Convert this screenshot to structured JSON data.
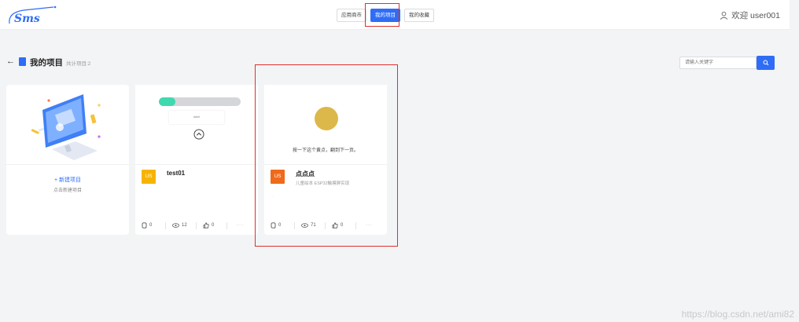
{
  "logo": {
    "text": "Sms"
  },
  "nav": {
    "tabs": [
      {
        "label": "应用商市"
      },
      {
        "label": "我的项目"
      },
      {
        "label": "我的收藏"
      }
    ]
  },
  "user": {
    "greeting": "欢迎 user001"
  },
  "page": {
    "back": "←",
    "title": "我的项目",
    "count": "共计项目:2"
  },
  "search": {
    "placeholder": "请输入关键字"
  },
  "new_card": {
    "title": "+ 新建项目",
    "subtitle": "点击新建项目"
  },
  "projects": [
    {
      "name": "test01",
      "avatar": "US",
      "avatar_color": "#f6b400",
      "desc": "",
      "preview_progress": 0.2,
      "preview_box_text": "label",
      "forks": "0",
      "views": "12",
      "likes": "0"
    },
    {
      "name": "点点点",
      "avatar": "US",
      "avatar_color": "#ef6a1a",
      "desc": "儿童绘本 ESP32触摸屏实现",
      "preview_text": "按一下这个黄点，翻到下一页。",
      "forks": "0",
      "views": "71",
      "likes": "0"
    }
  ],
  "more_label": "···",
  "watermark": "https://blog.csdn.net/ami82",
  "colors": {
    "accent": "#2f6df6",
    "highlight": "#e0302c",
    "progress": "#3fd9ae",
    "yellow_dot": "#dcb84a"
  }
}
